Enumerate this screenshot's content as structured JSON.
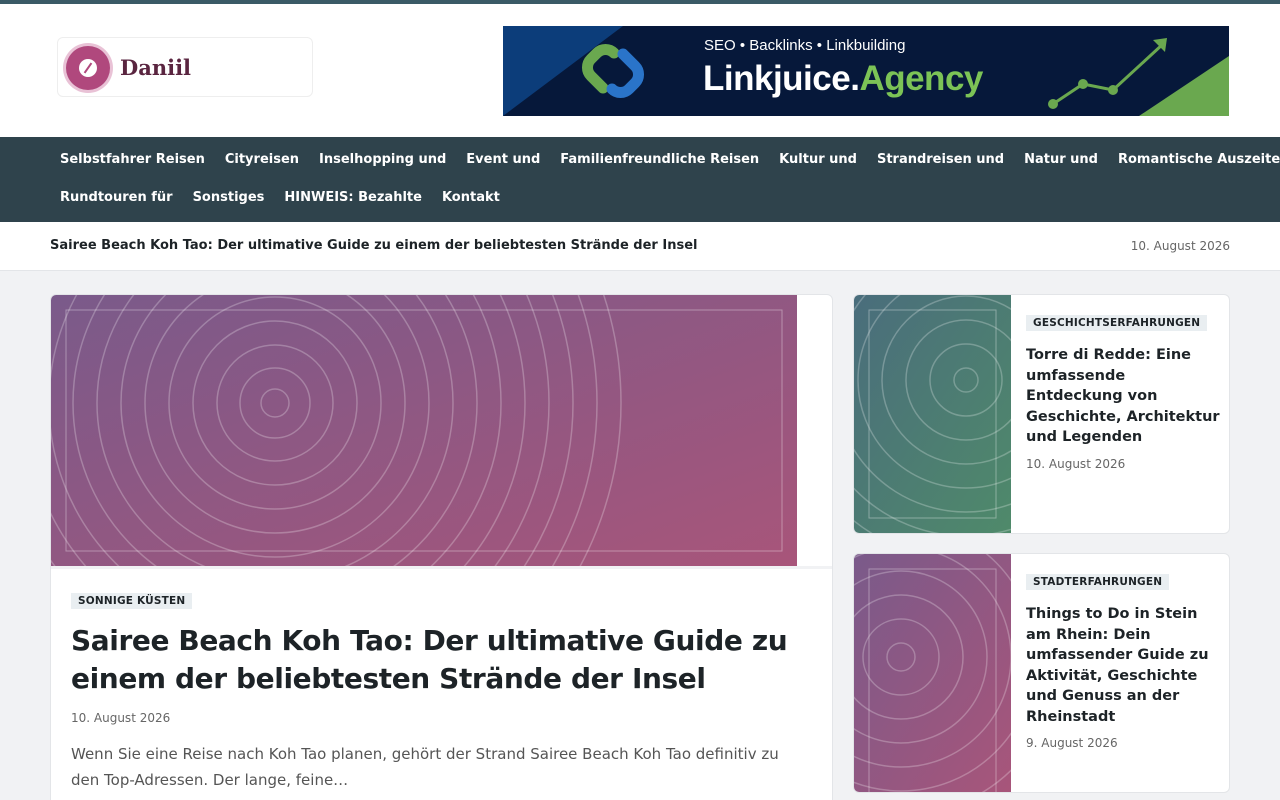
{
  "site": {
    "logo_text": "Daniil",
    "colors": {
      "accent": "#2f434c",
      "top_strip": "#3a5a66",
      "logo": "#b0487d"
    }
  },
  "banner": {
    "tagline": "SEO • Backlinks • Linkbuilding",
    "brand_main": "Linkjuice.",
    "brand_accent": "Agency"
  },
  "nav": {
    "row1": [
      "Selbstfahrer Reisen",
      "Cityreisen",
      "Inselhopping und",
      "Event und",
      "Familienfreundliche Reisen",
      "Kultur und",
      "Strandreisen und",
      "Natur und",
      "Romantische Auszeiten"
    ],
    "row2": [
      "Rundtouren für",
      "Sonstiges",
      "HINWEIS: Bezahlte",
      "Kontakt"
    ]
  },
  "ticker": {
    "title": "Sairee Beach Koh Tao: Der ultimative Guide zu einem der beliebtesten Strände der Insel",
    "date": "10. August 2026"
  },
  "hero": {
    "category": "SONNIGE KÜSTEN",
    "title": "Sairee Beach Koh Tao: Der ultimative Guide zu einem der beliebtesten Strände der Insel",
    "date": "10. August 2026",
    "excerpt": "Wenn Sie eine Reise nach Koh Tao planen, gehört der Strand Sairee Beach Koh Tao definitiv zu den Top-Adressen. Der lange, feine…"
  },
  "side_posts": [
    {
      "category": "GESCHICHTSERFAHRUNGEN",
      "title": "Torre di Redde: Eine umfassende Entdeckung von Geschichte, Architektur und Legenden",
      "date": "10. August 2026"
    },
    {
      "category": "STADTERFAHRUNGEN",
      "title": "Things to Do in Stein am Rhein: Dein umfassender Guide zu Aktivität, Geschichte und Genuss an der Rheinstadt",
      "date": "9. August 2026"
    }
  ]
}
